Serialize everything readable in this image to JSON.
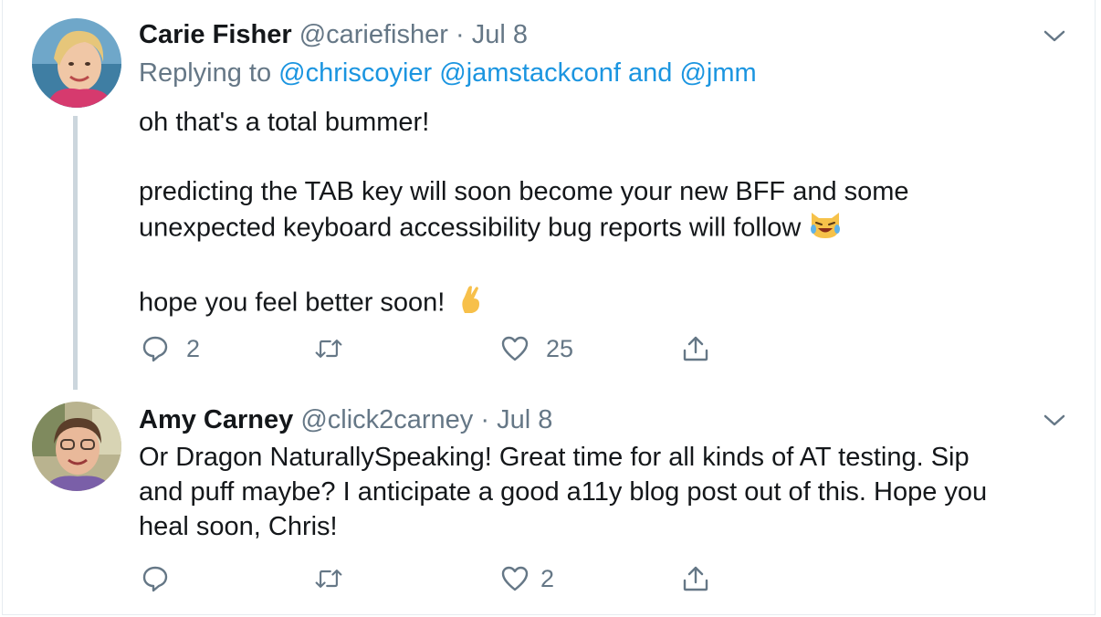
{
  "tweets": [
    {
      "author_name": "Carie Fisher",
      "handle": "@cariefisher",
      "separator": "·",
      "date": "Jul 8",
      "replying_prefix": "Replying to",
      "replying_user1": "@chriscoyier",
      "replying_user2": "@jamstackconf",
      "replying_and": "and",
      "replying_user3": "@jmm",
      "lines": [
        "oh that's a total bummer!",
        "predicting the TAB key will soon become your new BFF and some",
        "unexpected keyboard accessibility bug reports will follow",
        "hope you feel better soon!"
      ],
      "emoji1": "laughing-cat-emoji",
      "emoji2": "crossed-fingers-emoji",
      "reply_count": "2",
      "retweet_count": "",
      "like_count": "25"
    },
    {
      "author_name": "Amy Carney",
      "handle": "@click2carney",
      "separator": "·",
      "date": "Jul 8",
      "lines": [
        "Or Dragon NaturallySpeaking! Great time for all kinds of AT testing. Sip",
        "and puff maybe? I anticipate a good a11y blog post out of this. Hope you",
        "heal soon, Chris!"
      ],
      "reply_count": "",
      "retweet_count": "",
      "like_count": "2"
    }
  ],
  "colors": {
    "text": "#14171a",
    "secondary": "#657786",
    "link": "#1b95e0",
    "thread_line": "#ccd6dd",
    "border": "#e6ecf0"
  }
}
